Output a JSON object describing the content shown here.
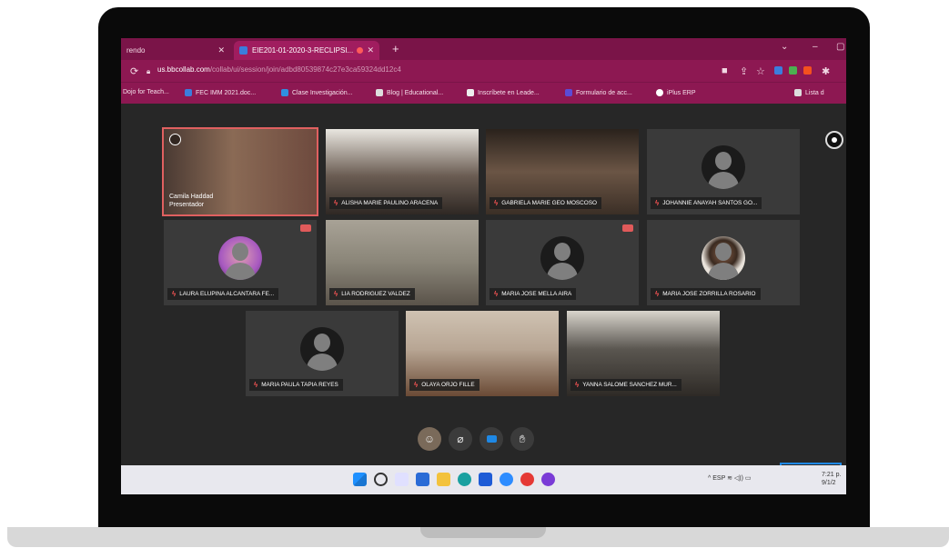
{
  "browser": {
    "tabs": [
      {
        "title": "rendo",
        "active": false
      },
      {
        "title": "EIE201-01-2020-3-RECLIPSI...",
        "active": true
      }
    ],
    "new_tab": "+",
    "url_host": "us.bbcollab.com",
    "url_path": "/collab/ui/session/join/adbd80539874c27e3ca59324dd12c4",
    "bookmarks": [
      {
        "label": "Dojo for Teach...",
        "color": "#2f6fd1"
      },
      {
        "label": "FEC IMM 2021.doc...",
        "color": "#3b7ddd"
      },
      {
        "label": "Clase Investigación...",
        "color": "#2f8fe0"
      },
      {
        "label": "Blog | Educational...",
        "color": "#5a5a5a"
      },
      {
        "label": "Inscríbete en Leade...",
        "color": "#1d1d1d"
      },
      {
        "label": "Formulario de acc...",
        "color": "#5b4bd6"
      },
      {
        "label": "iPlus ERP",
        "color": "#1d1d1d"
      }
    ],
    "reading_list": "Lista d"
  },
  "meeting": {
    "participants": [
      {
        "name": "Camila Haddad",
        "role": "Presentador",
        "video": true,
        "muted": false,
        "active": true,
        "bg": "#6e4a3e"
      },
      {
        "name": "ALISHA MARIE PAULINO ARACENA",
        "video": true,
        "muted": true,
        "bg": "#5a4e48"
      },
      {
        "name": "GABRIELA MARIE GEO MOSCOSO",
        "video": true,
        "muted": true,
        "bg": "#3b2f26"
      },
      {
        "name": "JOHANNIE ANAYAH SANTOS GO...",
        "video": false,
        "muted": true,
        "bg": "#3a3a3a"
      },
      {
        "name": "LAURA ELUPINA ALCANTARA FE...",
        "video": false,
        "muted": true,
        "hand": true,
        "bg": "#3a3a3a",
        "photo": "#a85ac0"
      },
      {
        "name": "LIA RODRIGUEZ VALDEZ",
        "video": true,
        "muted": true,
        "bg": "#8a8578"
      },
      {
        "name": "MARIA JOSE MELLA AIRA",
        "video": false,
        "muted": true,
        "hand": true,
        "bg": "#3a3a3a"
      },
      {
        "name": "MARIA JOSE ZORRILLA ROSARIO",
        "video": false,
        "muted": true,
        "bg": "#3a3a3a",
        "photo": "#e8e2da"
      },
      {
        "name": "MARIA PAULA TAPIA REYES",
        "video": false,
        "muted": true,
        "bg": "#3a3a3a"
      },
      {
        "name": "OLAYA ORJO FILLE",
        "video": true,
        "muted": true,
        "bg": "#b8a694"
      },
      {
        "name": "YANNA SALOME SANCHEZ MUR...",
        "video": true,
        "muted": true,
        "bg": "#5a5650"
      }
    ]
  },
  "taskbar": {
    "tray_text": "^  ESP",
    "time": "7:21 p.",
    "date": "9/1/2"
  }
}
